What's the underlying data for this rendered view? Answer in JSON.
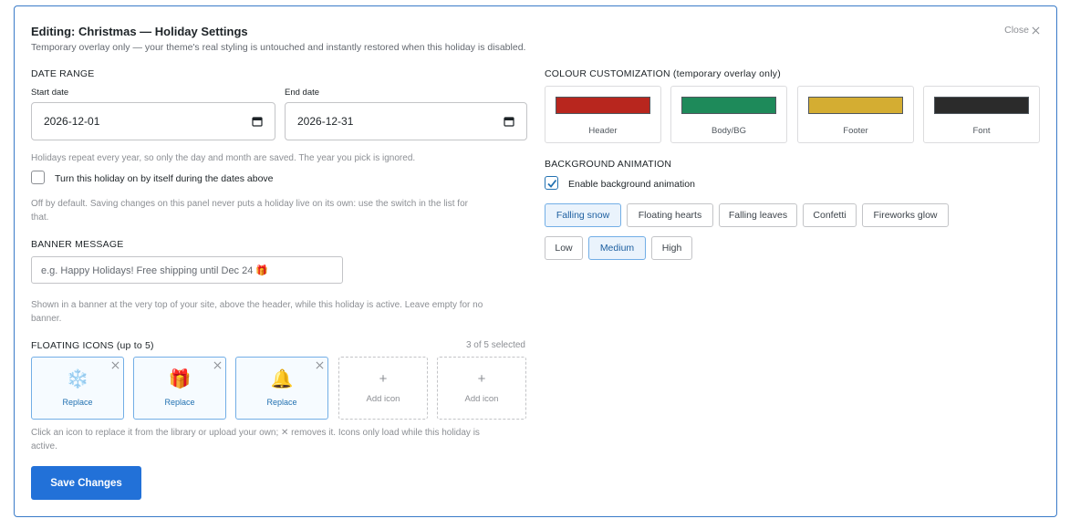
{
  "header": {
    "title": "Editing: Christmas — Holiday Settings",
    "subtitle": "Temporary overlay only — your theme's real styling is untouched and instantly restored when this holiday is disabled.",
    "close_label": "Close"
  },
  "date_range": {
    "section_label": "DATE RANGE",
    "start_label": "Start date",
    "start_value": "2026-12-01",
    "end_label": "End date",
    "end_value": "2026-12-31",
    "help": "Holidays repeat every year, so only the day and month are saved. The year you pick is ignored."
  },
  "auto_enable": {
    "label": "Turn this holiday on by itself during the dates above",
    "checked": false,
    "help_line1": "Off by default. Saving changes on this panel never puts a holiday live on its own: use the switch in the list for",
    "help_line2": "that."
  },
  "banner": {
    "section_label": "BANNER MESSAGE",
    "placeholder": "e.g. Happy Holidays! Free shipping until Dec 24 🎁",
    "help_line1": "Shown in a banner at the very top of your site, above the header, while this holiday is active. Leave empty for no",
    "help_line2": "banner."
  },
  "floating_icons": {
    "section_label": "FLOATING ICONS (up to 5)",
    "counter": "3 of 5 selected",
    "icons": [
      {
        "glyph": "❄️",
        "icon_name": "snowflake-icon",
        "caption": "Replace"
      },
      {
        "glyph": "🎁",
        "icon_name": "gift-icon",
        "caption": "Replace"
      },
      {
        "glyph": "🔔",
        "icon_name": "bell-icon",
        "caption": "Replace"
      }
    ],
    "add_slots": [
      {
        "plus": "+",
        "caption": "Add icon"
      },
      {
        "plus": "+",
        "caption": "Add icon"
      }
    ],
    "help_line1": "Click an icon to replace it from the library or upload your own; ✕ removes it. Icons only load while this holiday is",
    "help_line2": "active."
  },
  "save_label": "Save Changes",
  "colours": {
    "section_label": "COLOUR CUSTOMIZATION (temporary overlay only)",
    "swatches": [
      {
        "label": "Header",
        "color": "#b8261e"
      },
      {
        "label": "Body/BG",
        "color": "#1e8a5a"
      },
      {
        "label": "Footer",
        "color": "#d4ad32"
      },
      {
        "label": "Font",
        "color": "#2b2b2b"
      }
    ]
  },
  "animation": {
    "section_label": "BACKGROUND ANIMATION",
    "enable_label": "Enable background animation",
    "enabled": true,
    "types": [
      {
        "label": "Falling snow",
        "active": true
      },
      {
        "label": "Floating hearts",
        "active": false
      },
      {
        "label": "Falling leaves",
        "active": false
      },
      {
        "label": "Confetti",
        "active": false
      },
      {
        "label": "Fireworks glow",
        "active": false
      }
    ],
    "intensity": [
      {
        "label": "Low",
        "active": false
      },
      {
        "label": "Medium",
        "active": true
      },
      {
        "label": "High",
        "active": false
      }
    ]
  }
}
